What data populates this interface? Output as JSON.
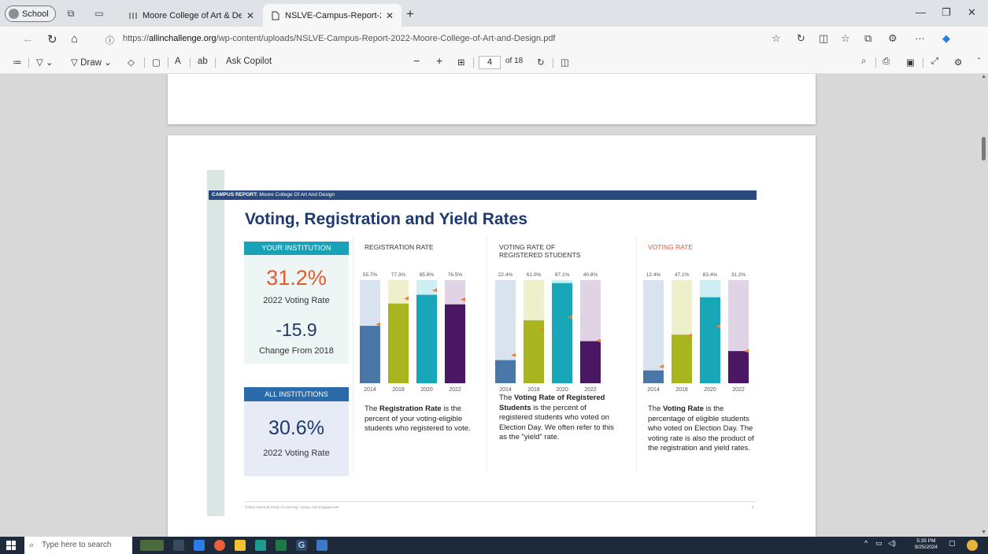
{
  "browser": {
    "profile_label": "School",
    "tabs": [
      {
        "label": "Moore College of Art & Design -",
        "active": false
      },
      {
        "label": "NSLVE-Campus-Report-2022-Mo",
        "active": true
      }
    ],
    "url_prefix": "https://",
    "url_domain": "allinchallenge.org",
    "url_path": "/wp-content/uploads/NSLVE-Campus-Report-2022-Moore-College-of-Art-and-Design.pdf"
  },
  "pdf_toolbar": {
    "draw_label": "Draw",
    "ask_copilot_label": "Ask Copilot",
    "page_current": "4",
    "page_total": "of 18"
  },
  "report": {
    "header_bold": "CAMPUS REPORT:",
    "header_text": " Moore College Of Art And Design",
    "title": "Voting, Registration and Yield Rates",
    "your_institution_tag": "YOUR INSTITUTION",
    "voting_rate_value": "31.2%",
    "voting_rate_label": "2022 Voting Rate",
    "change_value": "-15.9",
    "change_label": "Change From 2018",
    "all_institutions_tag": "ALL INSTITUTIONS",
    "all_voting_rate_value": "30.6%",
    "all_voting_rate_label": "2022 Voting Rate",
    "footnote": "©2024 National Study of Learning, Voting, and Engagement",
    "page_number": "4",
    "desc_registration": {
      "pre": "The ",
      "bold": "Registration Rate",
      "post": " is the percent of your voting-eligible students who registered to vote."
    },
    "desc_yield": {
      "pre": "The ",
      "bold": "Voting Rate of Registered Students",
      "post": " is the percent of registered students who voted on Election Day. We often refer to this as the \"yield\" rate."
    },
    "desc_voting": {
      "pre": "The ",
      "bold": "Voting Rate",
      "post": " is the percentage of eligible students who voted on Election Day. The voting rate is also the product of the registration and yield rates."
    }
  },
  "colors": {
    "bar_2014": "#4a76a8",
    "bar_2018": "#a9b51f",
    "bar_2020": "#17a7b8",
    "bar_2022": "#4a1763",
    "track_2014": "#d9e2ef",
    "track_2018": "#eef0cc",
    "track_2020": "#cdeef2",
    "track_2022": "#e1d3e6",
    "marker": "#e8813a"
  },
  "chart_data": [
    {
      "type": "bar",
      "title": "REGISTRATION RATE",
      "categories": [
        "2014",
        "2018",
        "2020",
        "2022"
      ],
      "values": [
        55.7,
        77.3,
        85.8,
        76.5
      ],
      "labels": [
        "55.7%",
        "77.3%",
        "85.8%",
        "76.5%"
      ],
      "markers": [
        57,
        82,
        90,
        81
      ],
      "ylim": [
        0,
        100
      ]
    },
    {
      "type": "bar",
      "title": "VOTING RATE OF REGISTERED STUDENTS",
      "title_lines": [
        "VOTING RATE OF",
        "REGISTERED STUDENTS"
      ],
      "categories": [
        "2014",
        "2018",
        "2020",
        "2022"
      ],
      "values": [
        22.4,
        61.0,
        97.1,
        40.8
      ],
      "labels": [
        "22.4%",
        "61.0%",
        "97.1%",
        "40.8%"
      ],
      "markers": [
        27,
        52,
        64,
        41
      ],
      "ylim": [
        0,
        100
      ]
    },
    {
      "type": "bar",
      "title": "VOTING RATE",
      "categories": [
        "2014",
        "2018",
        "2020",
        "2022"
      ],
      "values": [
        12.4,
        47.1,
        83.4,
        31.2
      ],
      "labels": [
        "12.4%",
        "47.1%",
        "83.4%",
        "31.2%"
      ],
      "markers": [
        16,
        46,
        55,
        31
      ],
      "ylim": [
        0,
        100
      ]
    }
  ],
  "taskbar": {
    "search_placeholder": "Type here to search",
    "time": "5:35 PM",
    "date": "9/25/2024"
  }
}
